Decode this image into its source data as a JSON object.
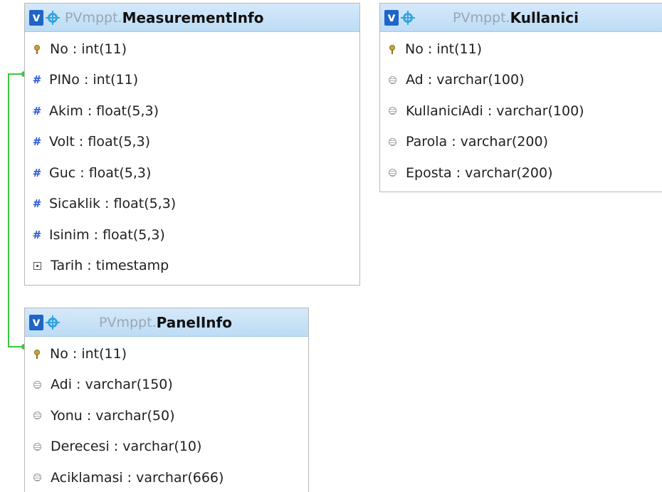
{
  "tables": {
    "measurement": {
      "db": "PVmppt.",
      "name": "MeasurementInfo",
      "columns": [
        {
          "icon": "key-icon",
          "text": "No : int(11)"
        },
        {
          "icon": "hash-icon",
          "text": "PINo : int(11)"
        },
        {
          "icon": "hash-icon",
          "text": "Akim : float(5,3)"
        },
        {
          "icon": "hash-icon",
          "text": "Volt : float(5,3)"
        },
        {
          "icon": "hash-icon",
          "text": "Guc : float(5,3)"
        },
        {
          "icon": "hash-icon",
          "text": "Sicaklik : float(5,3)"
        },
        {
          "icon": "hash-icon",
          "text": "Isinim : float(5,3)"
        },
        {
          "icon": "timestamp-icon",
          "text": "Tarih : timestamp"
        }
      ]
    },
    "kullanici": {
      "db": "PVmppt.",
      "name": "Kullanici",
      "columns": [
        {
          "icon": "key-icon",
          "text": "No : int(11)"
        },
        {
          "icon": "text-icon",
          "text": "Ad : varchar(100)"
        },
        {
          "icon": "text-icon",
          "text": "KullaniciAdi : varchar(100)"
        },
        {
          "icon": "text-icon",
          "text": "Parola : varchar(200)"
        },
        {
          "icon": "text-icon",
          "text": "Eposta : varchar(200)"
        }
      ]
    },
    "panel": {
      "db": "PVmppt.",
      "name": "PanelInfo",
      "columns": [
        {
          "icon": "key-icon",
          "text": "No : int(11)"
        },
        {
          "icon": "text-icon",
          "text": "Adi : varchar(150)"
        },
        {
          "icon": "text-icon",
          "text": "Yonu : varchar(50)"
        },
        {
          "icon": "text-icon",
          "text": "Derecesi : varchar(10)"
        },
        {
          "icon": "text-icon",
          "text": "Aciklamasi : varchar(666)"
        }
      ]
    }
  },
  "header_badge": "v",
  "relation_color": "#3cc83c",
  "header_color": "#c8e2f8"
}
